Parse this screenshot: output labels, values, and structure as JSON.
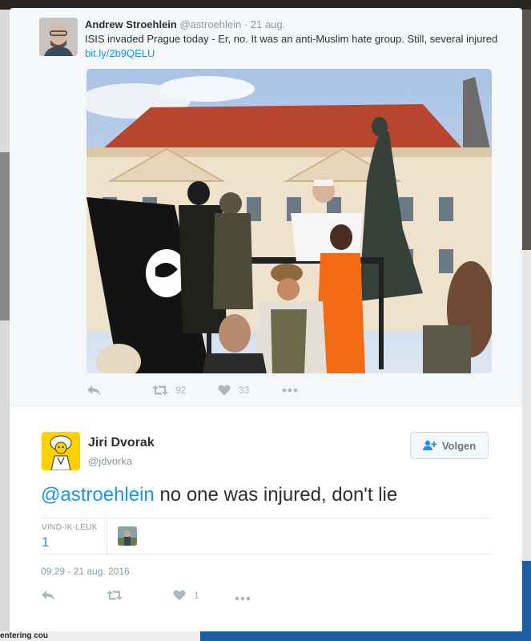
{
  "quoted_tweet": {
    "author_name": "Andrew Stroehlein",
    "author_handle": "@astroehlein",
    "separator": "·",
    "date": "21 aug.",
    "text": "ISIS invaded Prague today - Er, no. It was an anti-Muslim hate group. Still, several injured ",
    "link": "bit.ly/2b9QELU",
    "retweet_count": "92",
    "like_count": "33"
  },
  "tweet": {
    "author_name": "Jiri Dvorak",
    "author_handle": "@jdvorka",
    "follow_label": "Volgen",
    "mention": "@astroehlein",
    "text": " no one was injured, don't lie",
    "likes_label": "VIND-IK-LEUK",
    "likes_count": "1",
    "timestamp": "09:29 - 21 aug. 2016",
    "action_like_count": "1"
  },
  "background": {
    "bottom_left_text": "entering cou"
  },
  "icons": {
    "reply": "reply-icon",
    "retweet": "retweet-icon",
    "like": "heart-icon",
    "more": "more-icon",
    "follow": "add-user-icon"
  },
  "colors": {
    "link": "#1b95e0",
    "text": "#292f33",
    "muted": "#8899a6",
    "action_icon": "#aab8c2"
  }
}
